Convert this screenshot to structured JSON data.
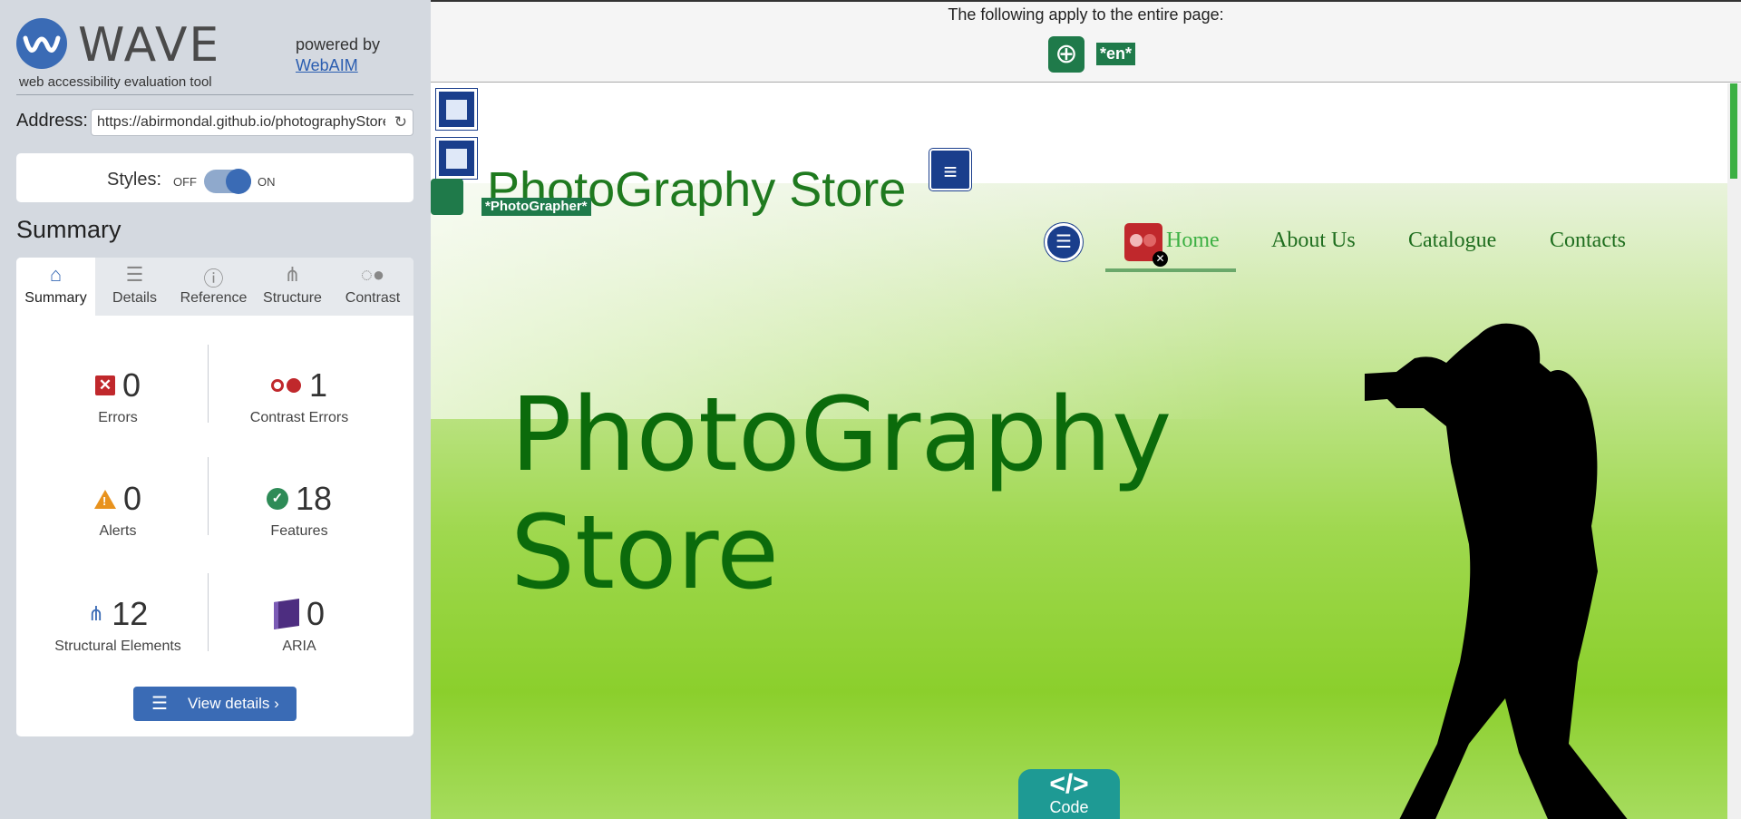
{
  "wave": {
    "logo_text": "WAVE",
    "tagline": "web accessibility evaluation tool",
    "powered_by": "powered by",
    "webaim_link": "WebAIM",
    "address_label": "Address:",
    "address_value": "https://abirmondal.github.io/photographyStore/",
    "styles_label": "Styles:",
    "styles_off": "OFF",
    "styles_on": "ON",
    "styles_enabled": true,
    "summary_heading": "Summary",
    "tabs": [
      {
        "label": "Summary",
        "icon": "home-icon",
        "active": true
      },
      {
        "label": "Details",
        "icon": "list-icon",
        "active": false
      },
      {
        "label": "Reference",
        "icon": "info-icon",
        "active": false
      },
      {
        "label": "Structure",
        "icon": "hierarchy-icon",
        "active": false
      },
      {
        "label": "Contrast",
        "icon": "contrast-icon",
        "active": false
      }
    ],
    "stats": {
      "errors": {
        "count": "0",
        "label": "Errors"
      },
      "contrast_errors": {
        "count": "1",
        "label": "Contrast Errors"
      },
      "alerts": {
        "count": "0",
        "label": "Alerts"
      },
      "features": {
        "count": "18",
        "label": "Features"
      },
      "structural": {
        "count": "12",
        "label": "Structural Elements"
      },
      "aria": {
        "count": "0",
        "label": "ARIA"
      }
    },
    "view_details": "View details ›",
    "colors": {
      "accent": "#3a6bb5",
      "error": "#c0282c",
      "alert": "#e8921d",
      "feature": "#2e8b57",
      "aria": "#4d2d80"
    }
  },
  "page": {
    "entire_page_note": "The following apply to the entire page:",
    "lang_tag": "*en*",
    "site_title": "PhotoGraphy Store",
    "alt_tag": "*PhotoGrapher*",
    "nav": [
      {
        "label": "Home",
        "active": true
      },
      {
        "label": "About Us",
        "active": false
      },
      {
        "label": "Catalogue",
        "active": false
      },
      {
        "label": "Contacts",
        "active": false
      }
    ],
    "hero_line1": "PhotoGraphy",
    "hero_line2": "Store",
    "code_button": "Code",
    "code_icon": "</>",
    "colors": {
      "title_green": "#1f7a1f",
      "hero_green": "#0b6b0b",
      "code_teal": "#1e9a94"
    }
  }
}
